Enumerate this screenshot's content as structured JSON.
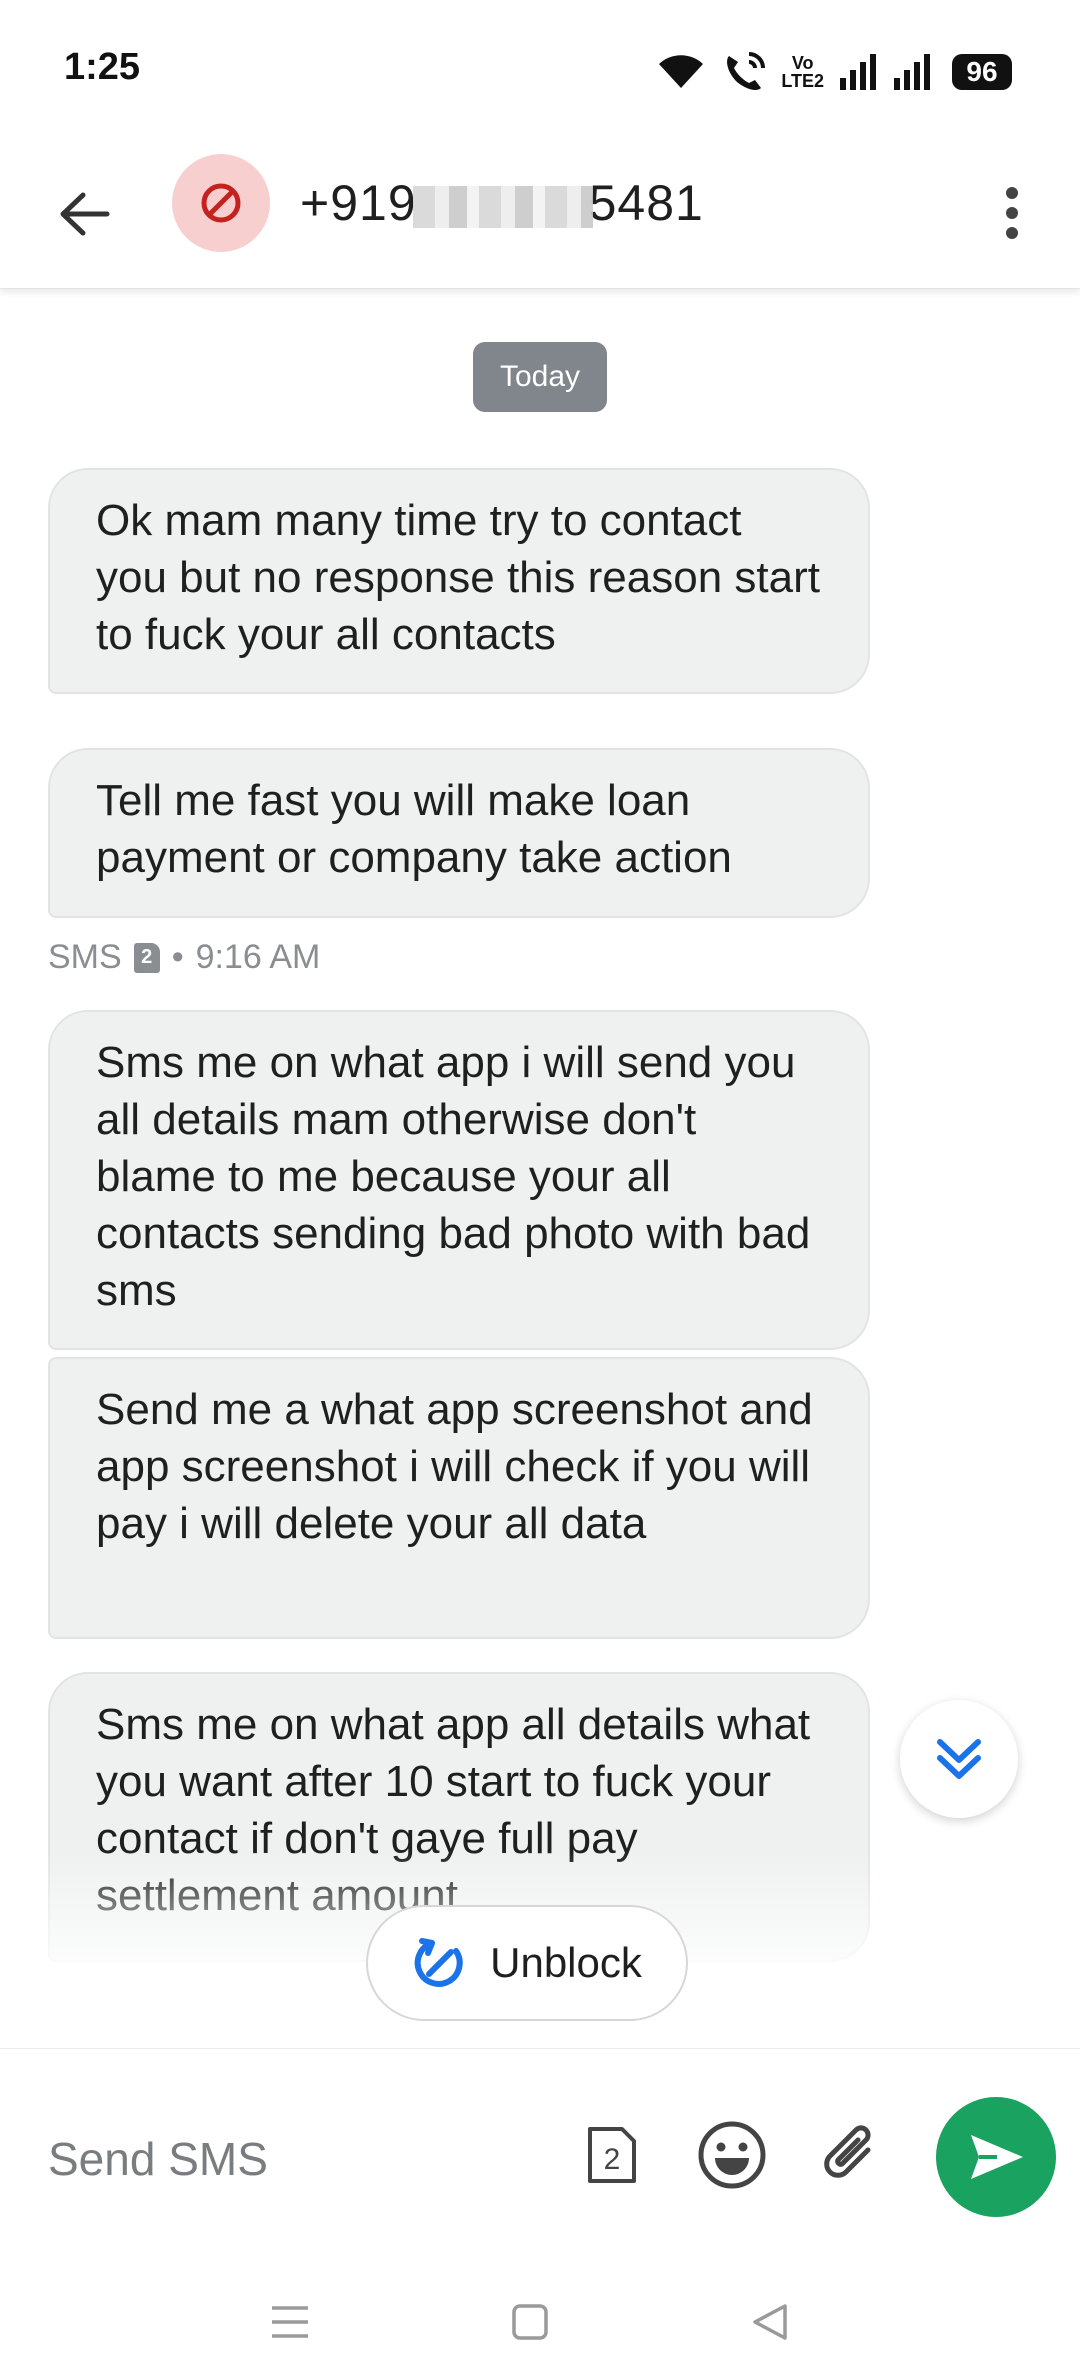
{
  "status_bar": {
    "time": "1:25",
    "volte_line1": "Vo",
    "volte_line2": "LTE2",
    "battery": "96"
  },
  "app_bar": {
    "contact_prefix": "+919",
    "contact_suffix": "5481"
  },
  "conversation": {
    "date_chip": "Today",
    "messages": [
      "Ok mam many time try to contact you but no response this reason start to fuck your all contacts",
      "Tell me fast you will make loan payment or company take action",
      "Sms me on what app i will send you all details mam otherwise don't blame to me because your all contacts sending bad photo with bad sms",
      "Send me a what app screenshot and app screenshot i will check if you will pay i will delete your all data",
      "Sms me on what app all details what you want after 10 start to fuck your contact if don't gaye full pay settlement amount"
    ],
    "meta": {
      "channel": "SMS",
      "sim": "2",
      "separator": "•",
      "time": "9:16 AM"
    }
  },
  "unblock_label": "Unblock",
  "compose": {
    "placeholder": "Send SMS",
    "sim": "2"
  },
  "colors": {
    "send": "#1aa260",
    "accent_blue": "#1a73e8",
    "block_red": "#c5221f",
    "bubble": "#eff0f0"
  }
}
